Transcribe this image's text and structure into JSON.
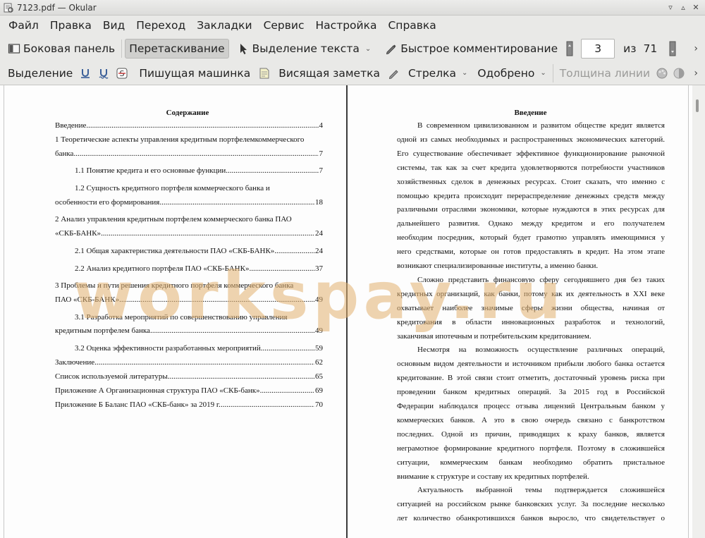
{
  "window": {
    "title": "7123.pdf  — Okular"
  },
  "menubar": {
    "items": [
      "Файл",
      "Правка",
      "Вид",
      "Переход",
      "Закладки",
      "Сервис",
      "Настройка",
      "Справка"
    ]
  },
  "toolbar1": {
    "sidebar": "Боковая панель",
    "drag": "Перетаскивание",
    "text_select": "Выделение текста",
    "quick_comment": "Быстрое комментирование",
    "page_current": "3",
    "page_of": "из",
    "page_total": "71"
  },
  "toolbar2": {
    "highlight": "Выделение",
    "typewriter": "Пишущая машинка",
    "sticky_note": "Висящая заметка",
    "arrow": "Стрелка",
    "approved": "Одобрено",
    "line_width": "Толщина линии"
  },
  "watermark": "workspay.ru",
  "toc": {
    "title": "Содержание",
    "entries": [
      {
        "text": "Введение",
        "page": "4"
      },
      {
        "text": "1 Теоретические аспекты управления кредитным портфелемкоммерческого",
        "page": ""
      },
      {
        "text": "банка",
        "page": "7"
      },
      {
        "text": "1.1 Понятие кредита и его основные функции",
        "page": "7"
      },
      {
        "text": "1.2 Сущность кредитного портфеля коммерческого банка и",
        "page": ""
      },
      {
        "text": "особенности его формирования",
        "page": "18"
      },
      {
        "text": "2 Анализ управления кредитным портфелем коммерческого банка ПАО",
        "page": ""
      },
      {
        "text": "«СКБ-БАНК»",
        "page": "24"
      },
      {
        "text": "2.1 Общая характеристика деятельности ПАО «СКБ-БАНК»",
        "page": "24"
      },
      {
        "text": "2.2 Анализ кредитного портфеля ПАО «СКБ-БАНК»",
        "page": "37"
      },
      {
        "text": "3 Проблемы и пути решения кредитного портфеля коммерческого банка",
        "page": ""
      },
      {
        "text": "ПАО «СКБ-БАНК»",
        "page": "49"
      },
      {
        "text": "3.1 Разработка мероприятий по совершенствованию управления",
        "page": ""
      },
      {
        "text": "кредитным портфелем банка",
        "page": "49"
      },
      {
        "text": "3.2 Оценка эффективности разработанных мероприятий",
        "page": "59"
      },
      {
        "text": "Заключение",
        "page": "62"
      },
      {
        "text": "Список используемой литературы",
        "page": "65"
      },
      {
        "text": "Приложение А Организационная структура ПАО «СКБ-банк»",
        "page": "69"
      },
      {
        "text": "Приложение Б Баланс ПАО «СКБ-банк» за 2019 г.",
        "page": "70"
      }
    ]
  },
  "intro": {
    "title": "Введение",
    "lines": [
      "В современном цивилизованном и развитом обществе кредит является",
      "одной из самых необходимых и распространенных экономических категорий.",
      "Его существование обеспечивает эффективное функционирование рыночной",
      "системы, так как за счет кредита удовлетворяются потребности участников",
      "хозяйственных сделок в денежных ресурсах. Стоит сказать, что именно с",
      "помощью кредита происходит перераспределение денежных средств между",
      "различными отраслями экономики, которые нуждаются в этих ресурсах для",
      "дальнейшего развития. Однако между кредитом и его получателем",
      "необходим посредник, который будет грамотно управлять имеющимися у",
      "него средствами, которые он готов предоставлять в кредит. На этом этапе",
      "возникают специализированные институты, а именно банки.",
      "Сложно представить финансовую сферу сегодняшнего дня без таких",
      "кредитных организаций, как банки, потому как их деятельность в XXI веке",
      "охватывает наиболее значимые сферы жизни общества, начиная от",
      "кредитования в области инновационных разработок и технологий,",
      "заканчивая ипотечным и потребительским кредитованием.",
      "Несмотря на возможность осуществление различных операций,",
      "основным видом деятельности и источником прибыли любого банка остается",
      "кредитование. В этой связи стоит отметить, достаточный уровень риска при",
      "проведении банком кредитных операций. За 2015 год в Российской",
      "Федерации наблюдался процесс отзыва лицензий Центральным банком у",
      "коммерческих банков. А это в свою очередь связано с банкротством",
      "последних. Одной из причин, приводящих к краху банков, является",
      "неграмотное формирование кредитного портфеля. Поэтому в сложившейся",
      "ситуации, коммерческим банкам необходимо обратить пристальное",
      "внимание к структуре и составу их кредитных портфелей.",
      "Актуальность выбранной темы подтверждается сложившейся",
      "ситуацией на российском рынке банковских услуг. За последние несколько",
      "лет количество обанкротившихся банков выросло, что свидетельствует о"
    ]
  }
}
